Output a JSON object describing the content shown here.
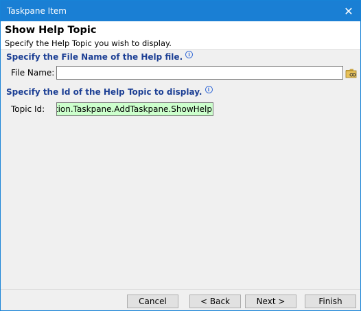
{
  "window": {
    "title": "Taskpane Item",
    "close_glyph": "✕"
  },
  "header": {
    "title": "Show Help Topic",
    "subtitle": "Specify the Help Topic you wish to display."
  },
  "file_section": {
    "heading": "Specify the File Name of the Help file.",
    "label": "File Name:",
    "value": "",
    "browse_icon": "folder-browse-icon"
  },
  "topic_section": {
    "heading": "Specify the Id of the Help Topic to display.",
    "label": "Topic Id:",
    "value": "entation.Taskpane.AddTaskpane.ShowHelp"
  },
  "buttons": {
    "cancel": "Cancel",
    "back": "< Back",
    "next": "Next >",
    "finish": "Finish"
  },
  "colors": {
    "titlebar": "#1a7fd4",
    "section_heading": "#1c3f94",
    "topic_field_bg": "#ccffcc"
  }
}
